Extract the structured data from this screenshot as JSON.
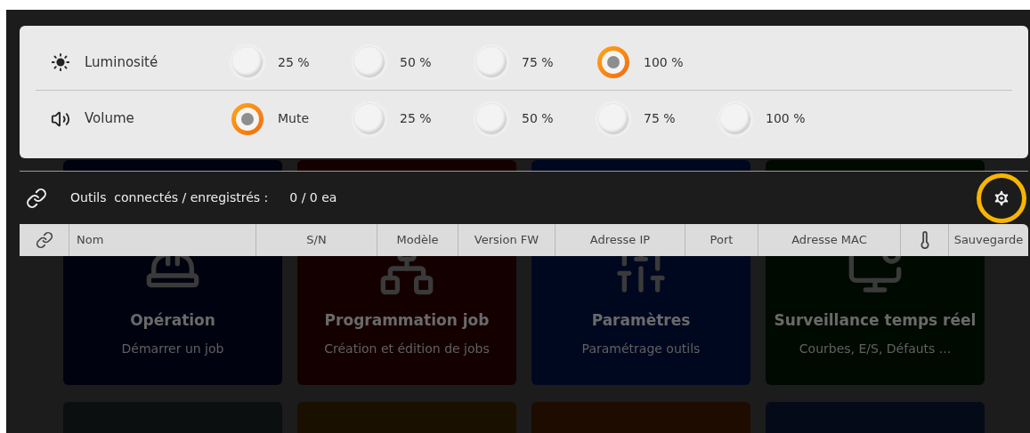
{
  "settings": [
    {
      "kind": "brightness",
      "label": "Luminosité",
      "options": [
        {
          "label": "25 %",
          "selected": false
        },
        {
          "label": "50 %",
          "selected": false
        },
        {
          "label": "75 %",
          "selected": false
        },
        {
          "label": "100 %",
          "selected": true
        }
      ]
    },
    {
      "kind": "volume",
      "label": "Volume",
      "options": [
        {
          "label": "Mute",
          "selected": true
        },
        {
          "label": "25 %",
          "selected": false
        },
        {
          "label": "50 %",
          "selected": false
        },
        {
          "label": "75 %",
          "selected": false
        },
        {
          "label": "100 %",
          "selected": false
        }
      ]
    }
  ],
  "tools": {
    "label": "Outils  connectés / enregistrés :",
    "value": "0 / 0 ea"
  },
  "table": {
    "columns": [
      {
        "kind": "link"
      },
      {
        "kind": "text",
        "label": "Nom"
      },
      {
        "kind": "text",
        "label": "S/N"
      },
      {
        "kind": "text",
        "label": "Modèle"
      },
      {
        "kind": "text",
        "label": "Version FW"
      },
      {
        "kind": "text",
        "label": "Adresse IP"
      },
      {
        "kind": "text",
        "label": "Port"
      },
      {
        "kind": "text",
        "label": "Adresse MAC"
      },
      {
        "kind": "temperature"
      },
      {
        "kind": "text",
        "label": "Sauvegarde"
      }
    ]
  },
  "tiles": [
    {
      "kind": "operator",
      "title": "Opération",
      "subtitle": "Démarrer un job",
      "color": "#00020f"
    },
    {
      "kind": "network",
      "title": "Programmation job",
      "subtitle": "Création et édition de jobs",
      "color": "#150000"
    },
    {
      "kind": "sliders",
      "title": "Paramètres",
      "subtitle": "Paramétrage outils",
      "color": "#000820"
    },
    {
      "kind": "monitor",
      "title": "Surveillance temps réel",
      "subtitle": "Courbes, E/S, Défauts ...",
      "color": "#000a00"
    },
    {
      "kind": "blank",
      "color": "#0b0f10"
    },
    {
      "kind": "blank",
      "color": "#1a1000"
    },
    {
      "kind": "blank",
      "color": "#1e0c00"
    },
    {
      "kind": "blank",
      "color": "#050a18"
    }
  ]
}
